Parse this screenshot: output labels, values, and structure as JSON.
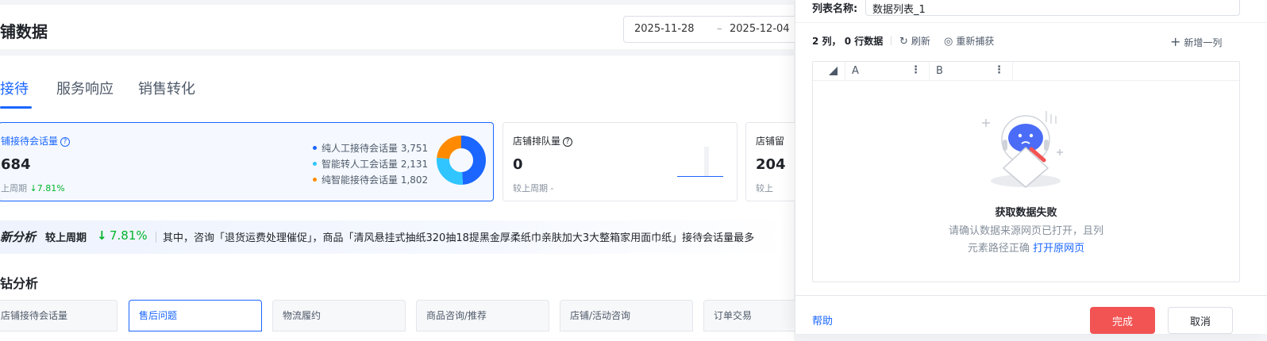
{
  "header": {
    "title": "铺数据",
    "date_start": "2025-11-28",
    "date_sep": "–",
    "date_end": "2025-12-04"
  },
  "tabs": [
    {
      "label": "接待"
    },
    {
      "label": "服务响应"
    },
    {
      "label": "销售转化"
    }
  ],
  "metrics": {
    "reception": {
      "label": "铺接待会话量",
      "value": "684",
      "compare_label": "上周期",
      "compare_value": "↓7.81%",
      "legend": [
        {
          "label": "纯人工接待会话量 3,751",
          "color": "#1a66ff"
        },
        {
          "label": "智能转人工会话量 2,131",
          "color": "#30c5ff"
        },
        {
          "label": "纯智能接待会话量 1,802",
          "color": "#ff8a00"
        }
      ]
    },
    "queue": {
      "label": "店铺排队量",
      "value": "0",
      "compare": "较上周期 -"
    },
    "third": {
      "label": "店铺留",
      "value": "204",
      "compare": "较上"
    }
  },
  "donut": {
    "values": [
      3751,
      2131,
      1802
    ],
    "colors": [
      "#1a66ff",
      "#30c5ff",
      "#ff8a00"
    ]
  },
  "analysis": {
    "title": "新分析",
    "compare_label": "较上周期",
    "arrow": "↓",
    "compare_value": "7.81%",
    "text": "其中，咨询「退货运费处理催促」，商品「清风悬挂式抽纸320抽18提黑金厚柔纸巾亲肤加大3大整箱家用面巾纸」接待会话量最多"
  },
  "section": {
    "title": "钻分析"
  },
  "category_tabs": [
    {
      "label": "店铺接待会话量"
    },
    {
      "label": "售后问题"
    },
    {
      "label": "物流履约"
    },
    {
      "label": "商品咨询/推荐"
    },
    {
      "label": "店铺/活动咨询"
    },
    {
      "label": "订单交易"
    }
  ],
  "panel": {
    "name_label": "列表名称:",
    "name_value": "数据列表_1",
    "stats": "2 列， 0 行数据",
    "refresh": "刷新",
    "recapture": "重新捕获",
    "add_column": "新增一列",
    "columns": [
      "A",
      "B"
    ],
    "empty_title": "获取数据失败",
    "empty_desc_line1": "请确认数据来源网页已打开，且列",
    "empty_desc_line2": "元素路径正确",
    "open_page": "打开原网页",
    "help": "帮助",
    "done": "完成",
    "cancel": "取消"
  }
}
